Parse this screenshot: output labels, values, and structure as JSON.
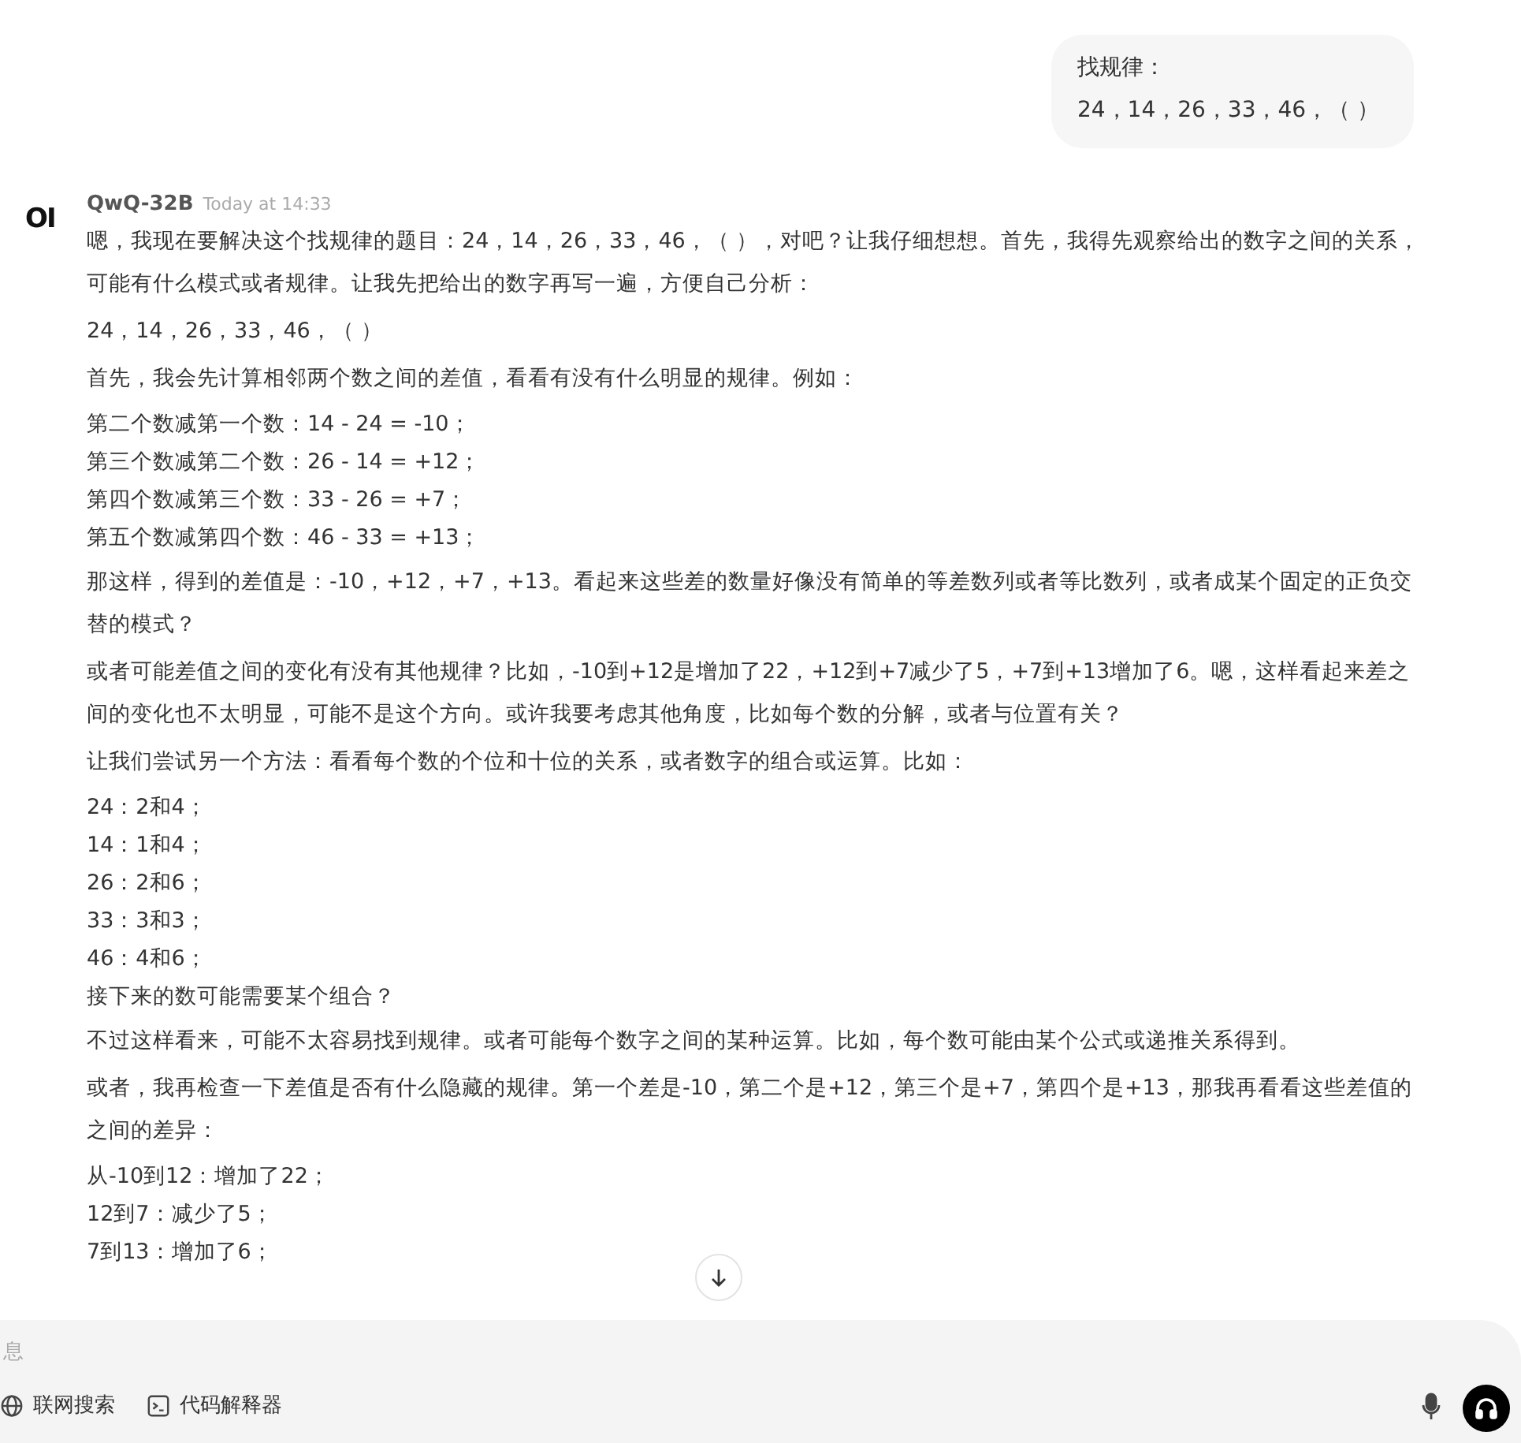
{
  "user_message": {
    "lines": [
      "找规律：",
      "24，14，26，33，46，（ ）"
    ]
  },
  "assistant": {
    "logo": "OI",
    "model": "QwQ-32B",
    "time": "Today at 14:33",
    "blocks": [
      {
        "kind": "paragraph",
        "lines": [
          "嗯，我现在要解决这个找规律的题目：24，14，26，33，46，（ ），对吧？让我仔细想想。首先，我得先观察给出的数字之间的关系，可能有什么模式或者规律。让我先把给出的数字再写一遍，方便自己分析："
        ]
      },
      {
        "kind": "paragraph",
        "lines": [
          "24，14，26，33，46，（ ）"
        ]
      },
      {
        "kind": "paragraph",
        "lines": [
          "首先，我会先计算相邻两个数之间的差值，看看有没有什么明显的规律。例如："
        ]
      },
      {
        "kind": "list",
        "lines": [
          "第二个数减第一个数：14 - 24 = -10；",
          "第三个数减第二个数：26 - 14 = +12；",
          "第四个数减第三个数：33 - 26 = +7；",
          "第五个数减第四个数：46 - 33 = +13；"
        ]
      },
      {
        "kind": "paragraph",
        "lines": [
          "那这样，得到的差值是：-10，+12，+7，+13。看起来这些差的数量好像没有简单的等差数列或者等比数列，或者成某个固定的正负交替的模式？"
        ]
      },
      {
        "kind": "paragraph",
        "lines": [
          "或者可能差值之间的变化有没有其他规律？比如，-10到+12是增加了22，+12到+7减少了5，+7到+13增加了6。嗯，这样看起来差之间的变化也不太明显，可能不是这个方向。或许我要考虑其他角度，比如每个数的分解，或者与位置有关？"
        ]
      },
      {
        "kind": "paragraph",
        "lines": [
          "让我们尝试另一个方法：看看每个数的个位和十位的关系，或者数字的组合或运算。比如："
        ]
      },
      {
        "kind": "list",
        "lines": [
          "24：2和4；",
          "14：1和4；",
          "26：2和6；",
          "33：3和3；",
          "46：4和6；",
          "接下来的数可能需要某个组合？"
        ]
      },
      {
        "kind": "paragraph",
        "lines": [
          "不过这样看来，可能不太容易找到规律。或者可能每个数字之间的某种运算。比如，每个数可能由某个公式或递推关系得到。"
        ]
      },
      {
        "kind": "paragraph",
        "lines": [
          "或者，我再检查一下差值是否有什么隐藏的规律。第一个差是-10，第二个是+12，第三个是+7，第四个是+13，那我再看看这些差值的之间的差异："
        ]
      },
      {
        "kind": "list",
        "lines": [
          "从-10到12：增加了22；",
          "12到7：减少了5；",
          "7到13：增加了6；"
        ]
      }
    ]
  },
  "composer": {
    "placeholder": "息",
    "tools": [
      {
        "kind": "globe",
        "label": "联网搜索"
      },
      {
        "kind": "terminal",
        "label": "代码解释器"
      }
    ]
  }
}
